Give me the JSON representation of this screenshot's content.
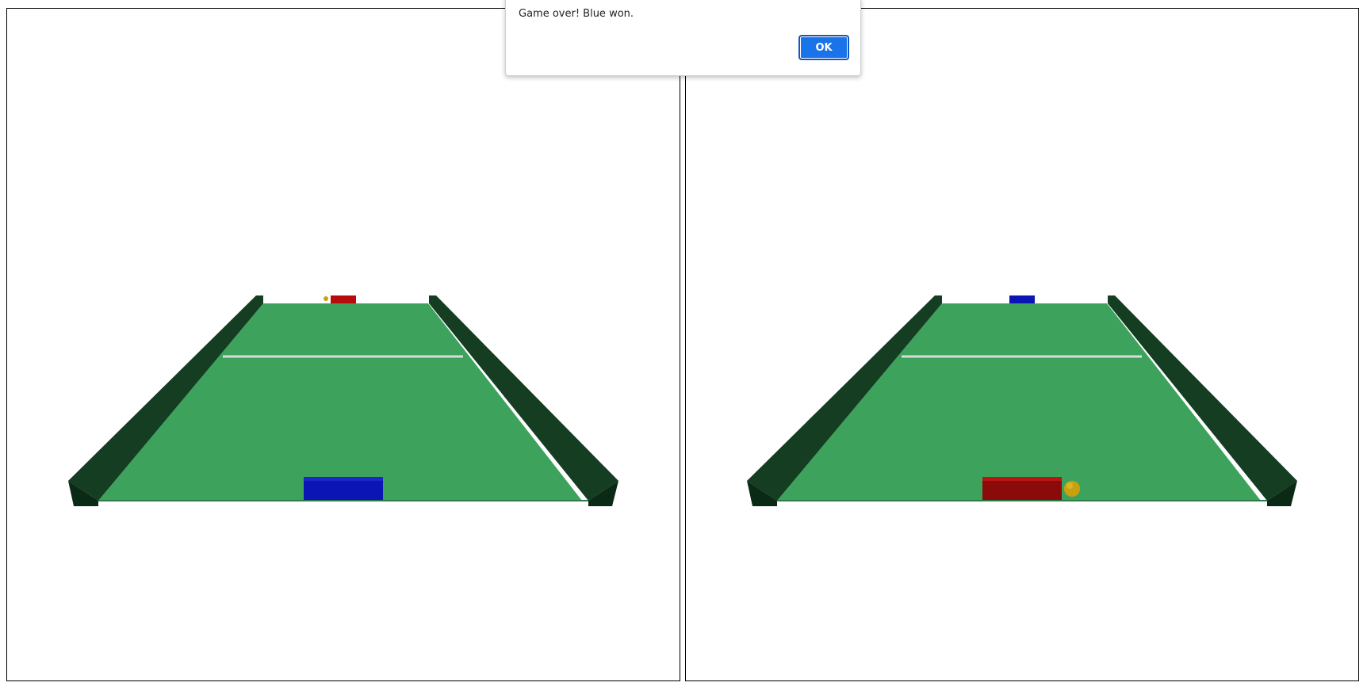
{
  "dialog": {
    "message": "Game over! Blue won.",
    "ok_label": "OK"
  },
  "views": [
    {
      "id": "left",
      "near_paddle": "blue",
      "far_paddle": "red",
      "ball": "far"
    },
    {
      "id": "right",
      "near_paddle": "red",
      "far_paddle": "blue",
      "ball": "near"
    }
  ],
  "colors": {
    "table": "#3da35c",
    "wall_top": "#143d22",
    "wall_face": "#0e2f1a",
    "net": "#dcdcdc",
    "blue_paddle": "#0b14b5",
    "red_paddle": "#b80b0b",
    "ball": "#c9a10f"
  }
}
